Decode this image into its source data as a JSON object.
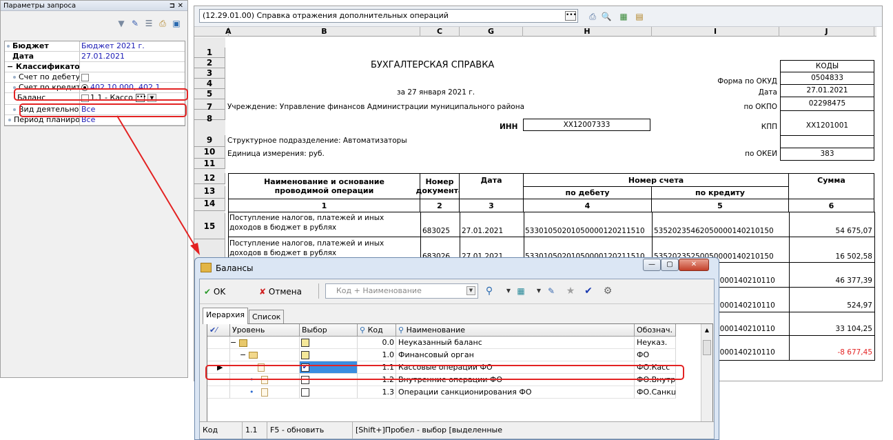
{
  "left_panel": {
    "title": "Параметры запроса",
    "params": [
      {
        "name": "Бюджет",
        "value": "Бюджет 2021 г."
      },
      {
        "name": "Дата",
        "value": "27.01.2021"
      },
      {
        "name": "Классификато",
        "value": ""
      },
      {
        "name": "Счет по дебету",
        "value": ""
      },
      {
        "name": "Счет по кредиту",
        "value": "402.10.000, 402.1"
      },
      {
        "name": "Баланс",
        "value": "1.1 - Кассо"
      },
      {
        "name": "Вид деятельнос",
        "value": "Все"
      },
      {
        "name": "Период планиров",
        "value": "Все"
      }
    ]
  },
  "report": {
    "selector": "(12.29.01.00) Справка отражения дополнительных операций",
    "columns": [
      "A",
      "B",
      "C",
      "G",
      "H",
      "I",
      "J"
    ],
    "rows": [
      "1",
      "2",
      "3",
      "4",
      "5",
      "7",
      "8",
      "9",
      "10",
      "11",
      "12",
      "13",
      "14",
      "15"
    ],
    "title": "БУХГАЛТЕРСКАЯ  СПРАВКА",
    "date_line": "за 27 января 2021 г.",
    "institution": "Учреждение: Управление финансов Администрации муниципального района",
    "subdivision": "Структурное подразделение: Автоматизаторы",
    "unit": "Единица измерения: руб.",
    "inn_label": "ИНН",
    "inn_value": "XX12007333",
    "codes_header": "КОДЫ",
    "labels": [
      "Форма по ОКУД",
      "Дата",
      "по ОКПО",
      "КПП",
      "по ОКЕИ"
    ],
    "codes": [
      "0504833",
      "27.01.2021",
      "02298475",
      "XX1201001",
      "",
      "383"
    ],
    "th_name1": "Наименование и основание",
    "th_name2": "проводимой операции",
    "th_num1": "Номер",
    "th_num2": "документа",
    "th_date": "Дата",
    "th_account": "Номер счета",
    "th_debit": "по дебету",
    "th_credit": "по кредиту",
    "th_sum": "Сумма",
    "th_index": [
      "1",
      "2",
      "3",
      "4",
      "5",
      "6"
    ],
    "op_text1": "Поступление налогов, платежей и иных",
    "op_text2": "доходов в бюджет в рублях",
    "entries": [
      {
        "doc": "683025",
        "date": "27.01.2021",
        "debit": "53301050201050000120211510",
        "credit": "53520235462050000140210150",
        "sum": "54 675,07"
      },
      {
        "doc": "683026",
        "date": "27.01.2021",
        "debit": "53301050201050000120211510",
        "credit": "53520235250050000140210150",
        "sum": "16 502,58"
      },
      {
        "credit": "0000140210110",
        "sum": "46 377,39"
      },
      {
        "credit": "0000140210110",
        "sum": "524,97"
      },
      {
        "credit": "0000140210110",
        "sum": "33 104,25"
      },
      {
        "credit": "0000140210110",
        "sum": "-8 677,45"
      }
    ]
  },
  "dialog": {
    "title": "Балансы",
    "ok": "OK",
    "cancel": "Отмена",
    "search_placeholder": "Код + Наименование",
    "tabs": [
      "Иерархия",
      "Список"
    ],
    "headers": [
      "Уровень",
      "Выбор",
      "Код",
      "Наименование",
      "Обознач."
    ],
    "rows": [
      {
        "code": "0.0",
        "name": "Неуказанный баланс",
        "abbr": "Неуказ."
      },
      {
        "code": "1.0",
        "name": "Финансовый орган",
        "abbr": "ФО"
      },
      {
        "code": "1.1",
        "name": "Кассовые операции ФО",
        "abbr": "ФО.Касс"
      },
      {
        "code": "1.2",
        "name": "Внутренние операции ФО",
        "abbr": "ФО.Внутр"
      },
      {
        "code": "1.3",
        "name": "Операции санкционирования ФО",
        "abbr": "ФО.Санкц"
      }
    ],
    "status": [
      "Код",
      "1.1",
      "F5 - обновить",
      "[Shift+]Пробел - выбор [выделенные"
    ]
  },
  "colors": {
    "highlight": "#e32222",
    "selection": "#3a8de0",
    "link": "#1a1ab5"
  }
}
